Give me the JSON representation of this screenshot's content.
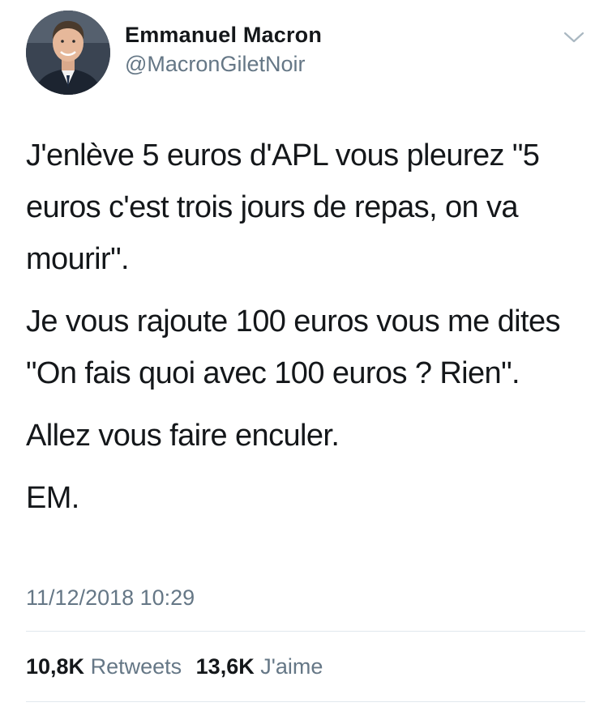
{
  "author": {
    "display_name": "Emmanuel Macron",
    "handle": "@MacronGiletNoir",
    "avatar": "profile-photo"
  },
  "tweet": {
    "paragraphs": [
      "J'enlève 5 euros d'APL vous pleurez \"5 euros c'est trois jours de repas, on va mourir\".",
      "Je vous rajoute 100 euros vous me dites \"On fais quoi avec 100 euros ? Rien\".",
      "Allez vous faire enculer.",
      "EM."
    ],
    "timestamp": "11/12/2018 10:29"
  },
  "stats": {
    "retweets_count": "10,8K",
    "retweets_label": "Retweets",
    "likes_count": "13,6K",
    "likes_label": "J'aime"
  },
  "icons": {
    "menu": "chevron-down-icon"
  },
  "colors": {
    "text": "#14171a",
    "secondary": "#657786",
    "divider": "#e1e8ed"
  }
}
